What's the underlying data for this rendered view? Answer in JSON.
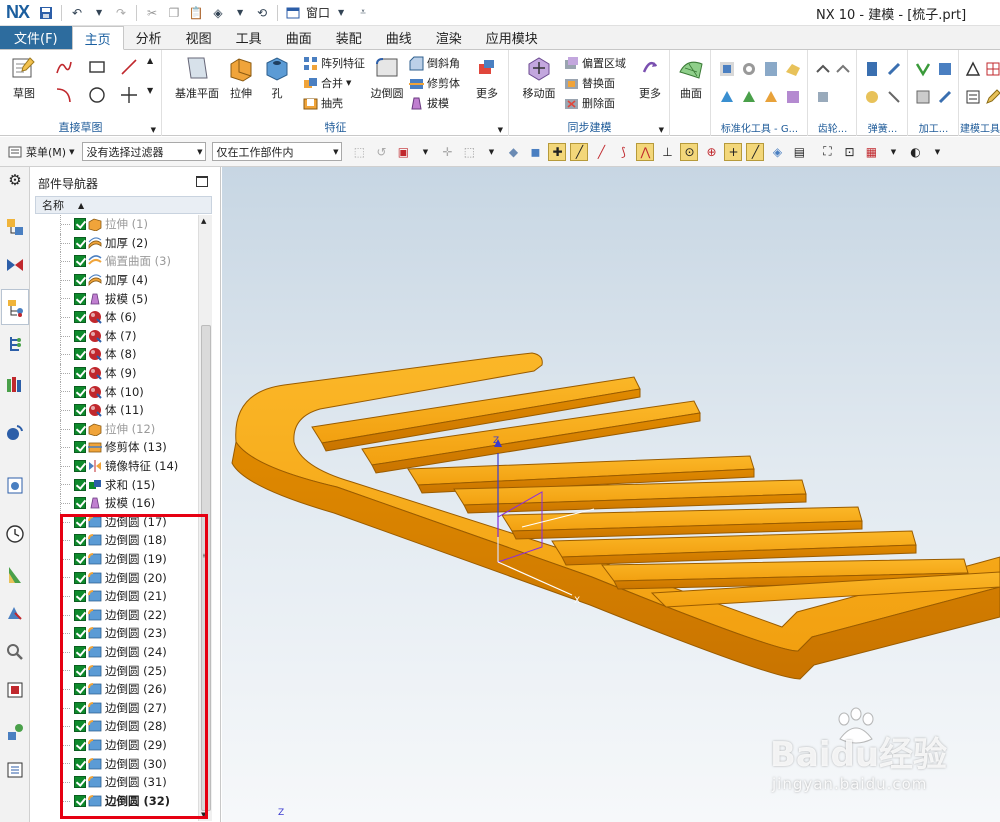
{
  "titlebar": {
    "logo": "NX",
    "window_menu": "窗口",
    "title": "NX 10 - 建模 - [梳子.prt]"
  },
  "ribbon_tabs": [
    "文件(F)",
    "主页",
    "分析",
    "视图",
    "工具",
    "曲面",
    "装配",
    "曲线",
    "渲染",
    "应用模块"
  ],
  "ribbon": {
    "sketch_group": {
      "label": "直接草图",
      "sketch": "草图"
    },
    "feature_group": {
      "label": "特征",
      "datum_plane": "基准平面",
      "extrude": "拉伸",
      "hole": "孔",
      "pattern": "阵列特征",
      "unite": "合并",
      "shell": "抽壳",
      "edge_blend": "边倒圆",
      "chamfer": "倒斜角",
      "trim_body": "修剪体",
      "draft": "拔模",
      "more": "更多"
    },
    "sync_group": {
      "label": "同步建模",
      "move_face": "移动面",
      "offset_region": "偏置区域",
      "replace_face": "替换面",
      "delete_face": "删除面",
      "more": "更多"
    },
    "surface_group": {
      "surface": "曲面"
    },
    "std_tools_label": "标准化工具 - G...",
    "gear_label": "齿轮...",
    "spring_label": "弹簧...",
    "machining_label": "加工...",
    "building_label": "建模工具"
  },
  "toolbar2": {
    "menu": "菜单(M)",
    "filter": "没有选择过滤器",
    "scope": "仅在工作部件内"
  },
  "navigator": {
    "title": "部件导航器",
    "column": "名称",
    "items": [
      {
        "label": "拉伸 (1)",
        "icon": "extrude-icon",
        "dim": true
      },
      {
        "label": "加厚 (2)",
        "icon": "thicken-icon",
        "dim": false
      },
      {
        "label": "偏置曲面 (3)",
        "icon": "offset-surface-icon",
        "dim": true
      },
      {
        "label": "加厚 (4)",
        "icon": "thicken-icon",
        "dim": false
      },
      {
        "label": "拔模 (5)",
        "icon": "draft-icon",
        "dim": false
      },
      {
        "label": "体 (6)",
        "icon": "body-icon",
        "dim": false
      },
      {
        "label": "体 (7)",
        "icon": "body-icon",
        "dim": false
      },
      {
        "label": "体 (8)",
        "icon": "body-icon",
        "dim": false
      },
      {
        "label": "体 (9)",
        "icon": "body-icon",
        "dim": false
      },
      {
        "label": "体 (10)",
        "icon": "body-icon",
        "dim": false
      },
      {
        "label": "体 (11)",
        "icon": "body-icon",
        "dim": false
      },
      {
        "label": "拉伸 (12)",
        "icon": "extrude-icon",
        "dim": true
      },
      {
        "label": "修剪体 (13)",
        "icon": "trim-body-icon",
        "dim": false
      },
      {
        "label": "镜像特征 (14)",
        "icon": "mirror-icon",
        "dim": false
      },
      {
        "label": "求和 (15)",
        "icon": "unite-icon",
        "dim": false
      },
      {
        "label": "拔模 (16)",
        "icon": "draft-icon",
        "dim": false
      },
      {
        "label": "边倒圆 (17)",
        "icon": "edge-blend-icon",
        "dim": false
      },
      {
        "label": "边倒圆 (18)",
        "icon": "edge-blend-icon",
        "dim": false
      },
      {
        "label": "边倒圆 (19)",
        "icon": "edge-blend-icon",
        "dim": false
      },
      {
        "label": "边倒圆 (20)",
        "icon": "edge-blend-icon",
        "dim": false
      },
      {
        "label": "边倒圆 (21)",
        "icon": "edge-blend-icon",
        "dim": false
      },
      {
        "label": "边倒圆 (22)",
        "icon": "edge-blend-icon",
        "dim": false
      },
      {
        "label": "边倒圆 (23)",
        "icon": "edge-blend-icon",
        "dim": false
      },
      {
        "label": "边倒圆 (24)",
        "icon": "edge-blend-icon",
        "dim": false
      },
      {
        "label": "边倒圆 (25)",
        "icon": "edge-blend-icon",
        "dim": false
      },
      {
        "label": "边倒圆 (26)",
        "icon": "edge-blend-icon",
        "dim": false
      },
      {
        "label": "边倒圆 (27)",
        "icon": "edge-blend-icon",
        "dim": false
      },
      {
        "label": "边倒圆 (28)",
        "icon": "edge-blend-icon",
        "dim": false
      },
      {
        "label": "边倒圆 (29)",
        "icon": "edge-blend-icon",
        "dim": false
      },
      {
        "label": "边倒圆 (30)",
        "icon": "edge-blend-icon",
        "dim": false
      },
      {
        "label": "边倒圆 (31)",
        "icon": "edge-blend-icon",
        "dim": false
      },
      {
        "label": "边倒圆 (32)",
        "icon": "edge-blend-icon",
        "dim": false,
        "bold": true
      }
    ]
  },
  "viewport": {
    "axis_x": "X",
    "axis_z": "Z",
    "model_color": "#f5a614",
    "watermark_main": "Baidu经验",
    "watermark_sub": "jingyan.baidu.com"
  },
  "colors": {
    "file_tab": "#2d6c9e",
    "highlight": "#e60012",
    "checkbox": "#0e8a2c"
  }
}
